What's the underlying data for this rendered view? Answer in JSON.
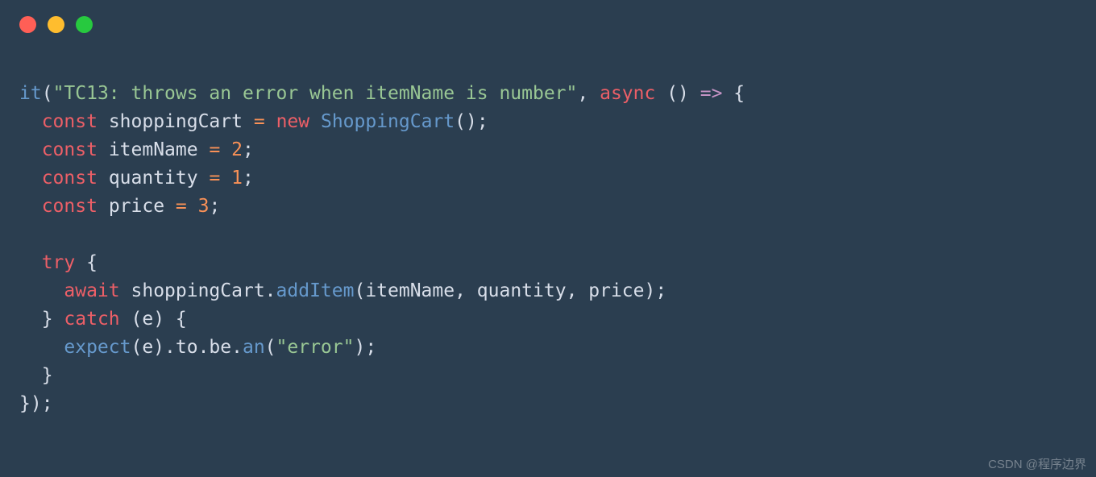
{
  "titlebar": {
    "dots": {
      "red": "#ff5f56",
      "yellow": "#ffbd2e",
      "green": "#27c93f"
    }
  },
  "code": {
    "line1_it": "it",
    "line1_paren_open": "(",
    "line1_string": "\"TC13: throws an error when itemName is number\"",
    "line1_comma_sp": ", ",
    "line1_async": "async",
    "line1_sp_parens": " () ",
    "line1_arrow": "=>",
    "line1_sp_brace": " {",
    "line2_indent": "  ",
    "line2_const": "const",
    "line2_sp": " ",
    "line2_var": "shoppingCart",
    "line2_sp2": " ",
    "line2_eq": "=",
    "line2_sp3": " ",
    "line2_new": "new",
    "line2_sp4": " ",
    "line2_class": "ShoppingCart",
    "line2_tail": "();",
    "line3_indent": "  ",
    "line3_const": "const",
    "line3_sp": " ",
    "line3_var": "itemName",
    "line3_sp2": " ",
    "line3_eq": "=",
    "line3_sp3": " ",
    "line3_val": "2",
    "line3_semi": ";",
    "line4_indent": "  ",
    "line4_const": "const",
    "line4_sp": " ",
    "line4_var": "quantity",
    "line4_sp2": " ",
    "line4_eq": "=",
    "line4_sp3": " ",
    "line4_val": "1",
    "line4_semi": ";",
    "line5_indent": "  ",
    "line5_const": "const",
    "line5_sp": " ",
    "line5_var": "price",
    "line5_sp2": " ",
    "line5_eq": "=",
    "line5_sp3": " ",
    "line5_val": "3",
    "line5_semi": ";",
    "line6_blank": "",
    "line7_indent": "  ",
    "line7_try": "try",
    "line7_sp": " ",
    "line7_brace": "{",
    "line8_indent": "    ",
    "line8_await": "await",
    "line8_sp": " ",
    "line8_obj": "shoppingCart",
    "line8_dot": ".",
    "line8_method": "addItem",
    "line8_args": "(itemName, quantity, price);",
    "line9_indent": "  ",
    "line9_brace_close": "}",
    "line9_sp": " ",
    "line9_catch": "catch",
    "line9_sp2": " ",
    "line9_paren": "(e) {",
    "line10_indent": "    ",
    "line10_expect": "expect",
    "line10_args1": "(e).to.be.",
    "line10_an": "an",
    "line10_paren_open": "(",
    "line10_string": "\"error\"",
    "line10_tail": ");",
    "line11_indent": "  ",
    "line11_brace": "}",
    "line12_close": "});"
  },
  "watermark": "CSDN @程序边界"
}
